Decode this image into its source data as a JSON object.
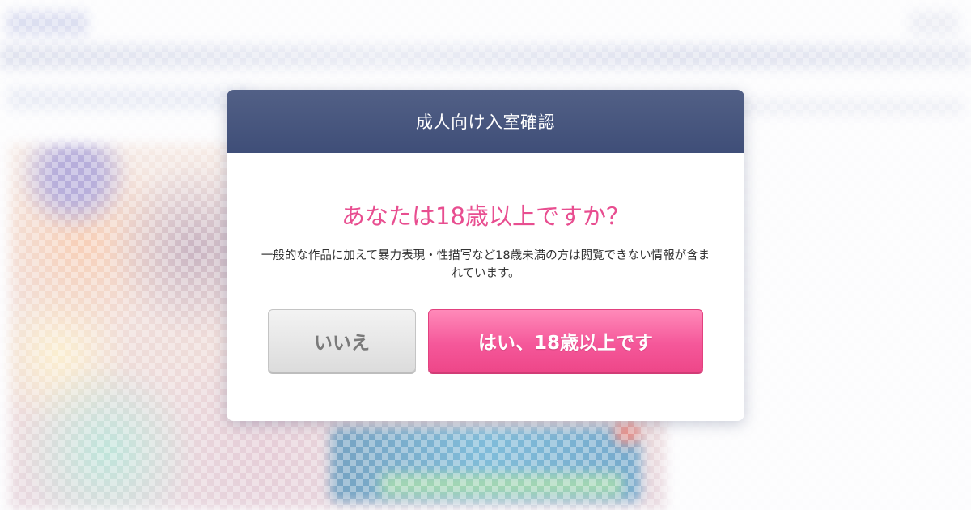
{
  "modal": {
    "title": "成人向け入室確認",
    "question": "あなたは18歳以上ですか？",
    "description": "一般的な作品に加えて暴力表現・性描写など18歳未満の方は閲覧できない情報が含まれています。",
    "no_button_label": "いいえ",
    "yes_button_label": "はい、18歳以上です"
  },
  "colors": {
    "header_bg": "#465580",
    "accent_pink": "#e84e90",
    "yes_button": "#f5589a",
    "no_button": "#e6e6e6"
  }
}
